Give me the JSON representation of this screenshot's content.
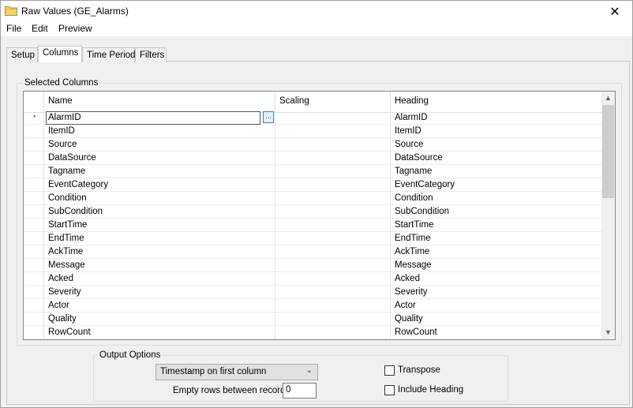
{
  "window": {
    "title": "Raw Values (GE_Alarms)",
    "close_glyph": "✕"
  },
  "menu": {
    "items": [
      "File",
      "Edit",
      "Preview"
    ]
  },
  "tabs": [
    {
      "label": "Setup",
      "active": false
    },
    {
      "label": "Columns",
      "active": true
    },
    {
      "label": "Time Period",
      "active": false
    },
    {
      "label": "Filters",
      "active": false
    }
  ],
  "selected_columns": {
    "group_label": "Selected Columns",
    "headers": {
      "name": "Name",
      "scaling": "Scaling",
      "heading": "Heading"
    },
    "current_row_marker": "*",
    "ellipsis": "...",
    "rows": [
      {
        "name": "AlarmID",
        "scaling": "",
        "heading": "AlarmID"
      },
      {
        "name": "ItemID",
        "scaling": "",
        "heading": "ItemID"
      },
      {
        "name": "Source",
        "scaling": "",
        "heading": "Source"
      },
      {
        "name": "DataSource",
        "scaling": "",
        "heading": "DataSource"
      },
      {
        "name": "Tagname",
        "scaling": "",
        "heading": "Tagname"
      },
      {
        "name": "EventCategory",
        "scaling": "",
        "heading": "EventCategory"
      },
      {
        "name": "Condition",
        "scaling": "",
        "heading": "Condition"
      },
      {
        "name": "SubCondition",
        "scaling": "",
        "heading": "SubCondition"
      },
      {
        "name": "StartTime",
        "scaling": "",
        "heading": "StartTime"
      },
      {
        "name": "EndTime",
        "scaling": "",
        "heading": "EndTime"
      },
      {
        "name": "AckTime",
        "scaling": "",
        "heading": "AckTime"
      },
      {
        "name": "Message",
        "scaling": "",
        "heading": "Message"
      },
      {
        "name": "Acked",
        "scaling": "",
        "heading": "Acked"
      },
      {
        "name": "Severity",
        "scaling": "",
        "heading": "Severity"
      },
      {
        "name": "Actor",
        "scaling": "",
        "heading": "Actor"
      },
      {
        "name": "Quality",
        "scaling": "",
        "heading": "Quality"
      },
      {
        "name": "RowCount",
        "scaling": "",
        "heading": "RowCount"
      }
    ]
  },
  "output_options": {
    "group_label": "Output Options",
    "timestamp_select": {
      "selected": "Timestamp on first column"
    },
    "empty_rows_label": "Empty rows between records",
    "empty_rows_value": "0",
    "transpose": {
      "label": "Transpose",
      "checked": false
    },
    "include_heading": {
      "label": "Include Heading",
      "checked": false
    }
  },
  "icons": {
    "title_icon": "folder-icon",
    "close_icon": "close-icon",
    "dropdown_icon": "chevron-down-icon",
    "scroll_up": "scroll-up-icon",
    "scroll_down": "scroll-down-icon"
  },
  "colors": {
    "folder": "#e8c45a",
    "focus_blue": "#3b7fd4"
  }
}
